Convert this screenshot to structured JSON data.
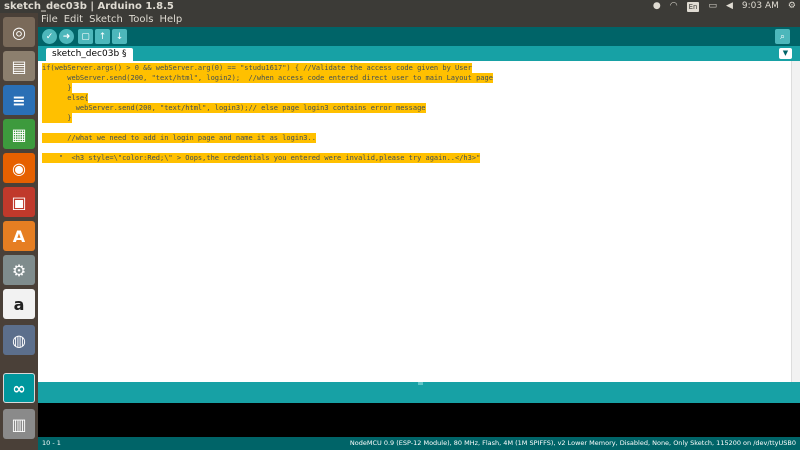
{
  "window": {
    "title": "sketch_dec03b | Arduino 1.8.5"
  },
  "system_tray": {
    "keyboard": "En",
    "clock": "9:03 AM"
  },
  "menubar": {
    "items": [
      "File",
      "Edit",
      "Sketch",
      "Tools",
      "Help"
    ]
  },
  "toolbar": {
    "buttons": [
      "verify-icon",
      "upload-icon",
      "new-icon",
      "open-icon",
      "save-icon"
    ],
    "serial_monitor_icon": "magnifier-icon"
  },
  "tabs": {
    "active": "sketch_dec03b §"
  },
  "editor": {
    "highlight_color": "#ffc000",
    "lines": [
      "if(webServer.args() > 0 && webServer.arg(0) == \"studu1617\") { //Validate the access code given by User",
      "      webServer.send(200, \"text/html\", login2);  //when access code entered direct user to main Layout page",
      "      }",
      "      else{",
      "        webServer.send(200, \"text/html\", login3);// else page login3 contains error message",
      "      }",
      "",
      "      //what we need to add in login page and name it as login3..",
      "",
      "    \"  <h3 style=\\\"color:Red;\\\" > Oops,the credentials you entered were invalid,please try again..</h3>\""
    ]
  },
  "status": {
    "line": "10 - 1",
    "board": "NodeMCU 0.9 (ESP-12 Module), 80 MHz, Flash, 4M (1M SPIFFS), v2 Lower Memory, Disabled, None, Only Sketch, 115200 on /dev/ttyUSB0"
  },
  "launcher": {
    "items": [
      "ubuntu-dash-icon",
      "files-icon",
      "writer-icon",
      "calc-icon",
      "firefox-icon",
      "impress-icon",
      "software-center-icon",
      "settings-icon",
      "amazon-icon",
      "disk-icon",
      "arduino-icon",
      "trash-icon"
    ]
  },
  "colors": {
    "arduino_teal": "#006468",
    "arduino_light_teal": "#17a1a5",
    "launcher": "#4a4038"
  }
}
